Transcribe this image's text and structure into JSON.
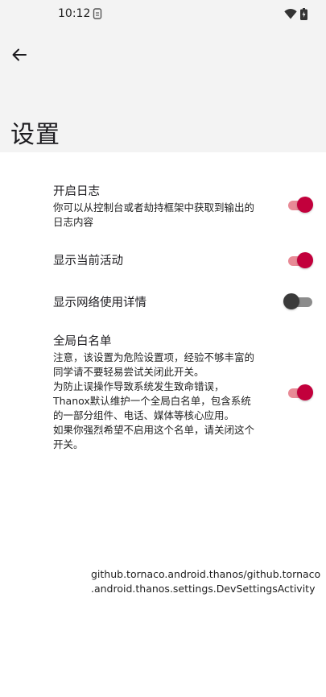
{
  "status_bar": {
    "time": "10:12",
    "icons": [
      "sim-card-icon",
      "wifi-icon",
      "battery-icon"
    ]
  },
  "app_bar": {
    "back_icon": "arrow-left-icon",
    "title": "设置"
  },
  "settings": {
    "items": [
      {
        "title": "开启日志",
        "summary": "你可以从控制台或者劫持框架中获取到输出的\n日志内容",
        "enabled": true
      },
      {
        "title": "显示当前活动",
        "summary": "",
        "enabled": true
      },
      {
        "title": "显示网络使用详情",
        "summary": "",
        "enabled": false
      },
      {
        "title": "全局白名单",
        "summary": "注意，该设置为危险设置项，经验不够丰富的\n同学请不要轻易尝试关闭此开关。\n为防止误操作导致系统发生致命错误，\nThanox默认维护一个全局白名单，包含系统\n的一部分组件、电话、媒体等核心应用。\n如果你强烈希望不启用这个名单，请关闭这个\n开关。",
        "enabled": true
      }
    ]
  },
  "footer": {
    "activity_name": "github.tornaco.android.thanos/github.tornaco\n.android.thanos.settings.DevSettingsActivity"
  },
  "colors": {
    "accent": "#c2003c",
    "accent_track": "#e88a96",
    "header_bg": "#f3f3f3"
  }
}
